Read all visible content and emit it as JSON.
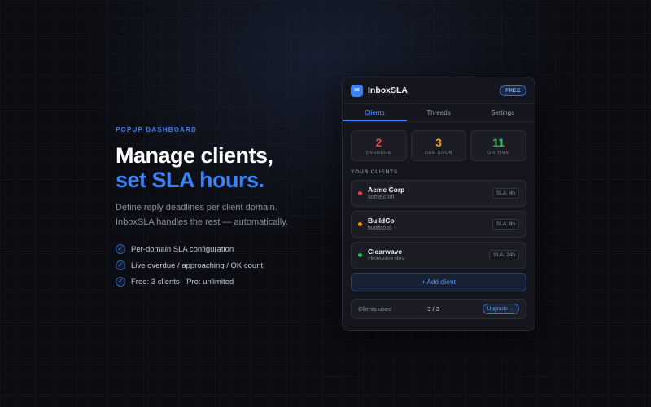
{
  "hero": {
    "eyebrow": "POPUP DASHBOARD",
    "headline_line1": "Manage clients,",
    "headline_line2": "set SLA hours.",
    "description": "Define reply deadlines per client domain. InboxSLA handles the rest — automatically.",
    "features": [
      "Per-domain SLA configuration",
      "Live overdue / approaching / OK count",
      "Free: 3 clients · Pro: unlimited"
    ]
  },
  "popup": {
    "app_name": "InboxSLA",
    "plan_badge": "FREE",
    "tabs": [
      {
        "label": "Clients",
        "active": true
      },
      {
        "label": "Threads",
        "active": false
      },
      {
        "label": "Settings",
        "active": false
      }
    ],
    "stats": [
      {
        "value": "2",
        "label": "OVERDUE",
        "color": "#ef4444"
      },
      {
        "value": "3",
        "label": "DUE SOON",
        "color": "#f59e0b"
      },
      {
        "value": "11",
        "label": "ON TIME",
        "color": "#22c55e"
      }
    ],
    "section_title": "YOUR CLIENTS",
    "clients": [
      {
        "name": "Acme Corp",
        "domain": "acme.com",
        "sla": "SLA: 4h",
        "status_color": "#ef4444"
      },
      {
        "name": "BuildCo",
        "domain": "buildco.io",
        "sla": "SLA: 8h",
        "status_color": "#f59e0b"
      },
      {
        "name": "Clearwave",
        "domain": "clearwave.dev",
        "sla": "SLA: 24h",
        "status_color": "#22c55e"
      }
    ],
    "add_client_label": "+ Add client",
    "usage": {
      "label": "Clients used",
      "count": "3 / 3",
      "upgrade_label": "Upgrade →"
    }
  },
  "colors": {
    "accent": "#3b82f6",
    "background": "#0c0d12",
    "card": "#15161d"
  }
}
